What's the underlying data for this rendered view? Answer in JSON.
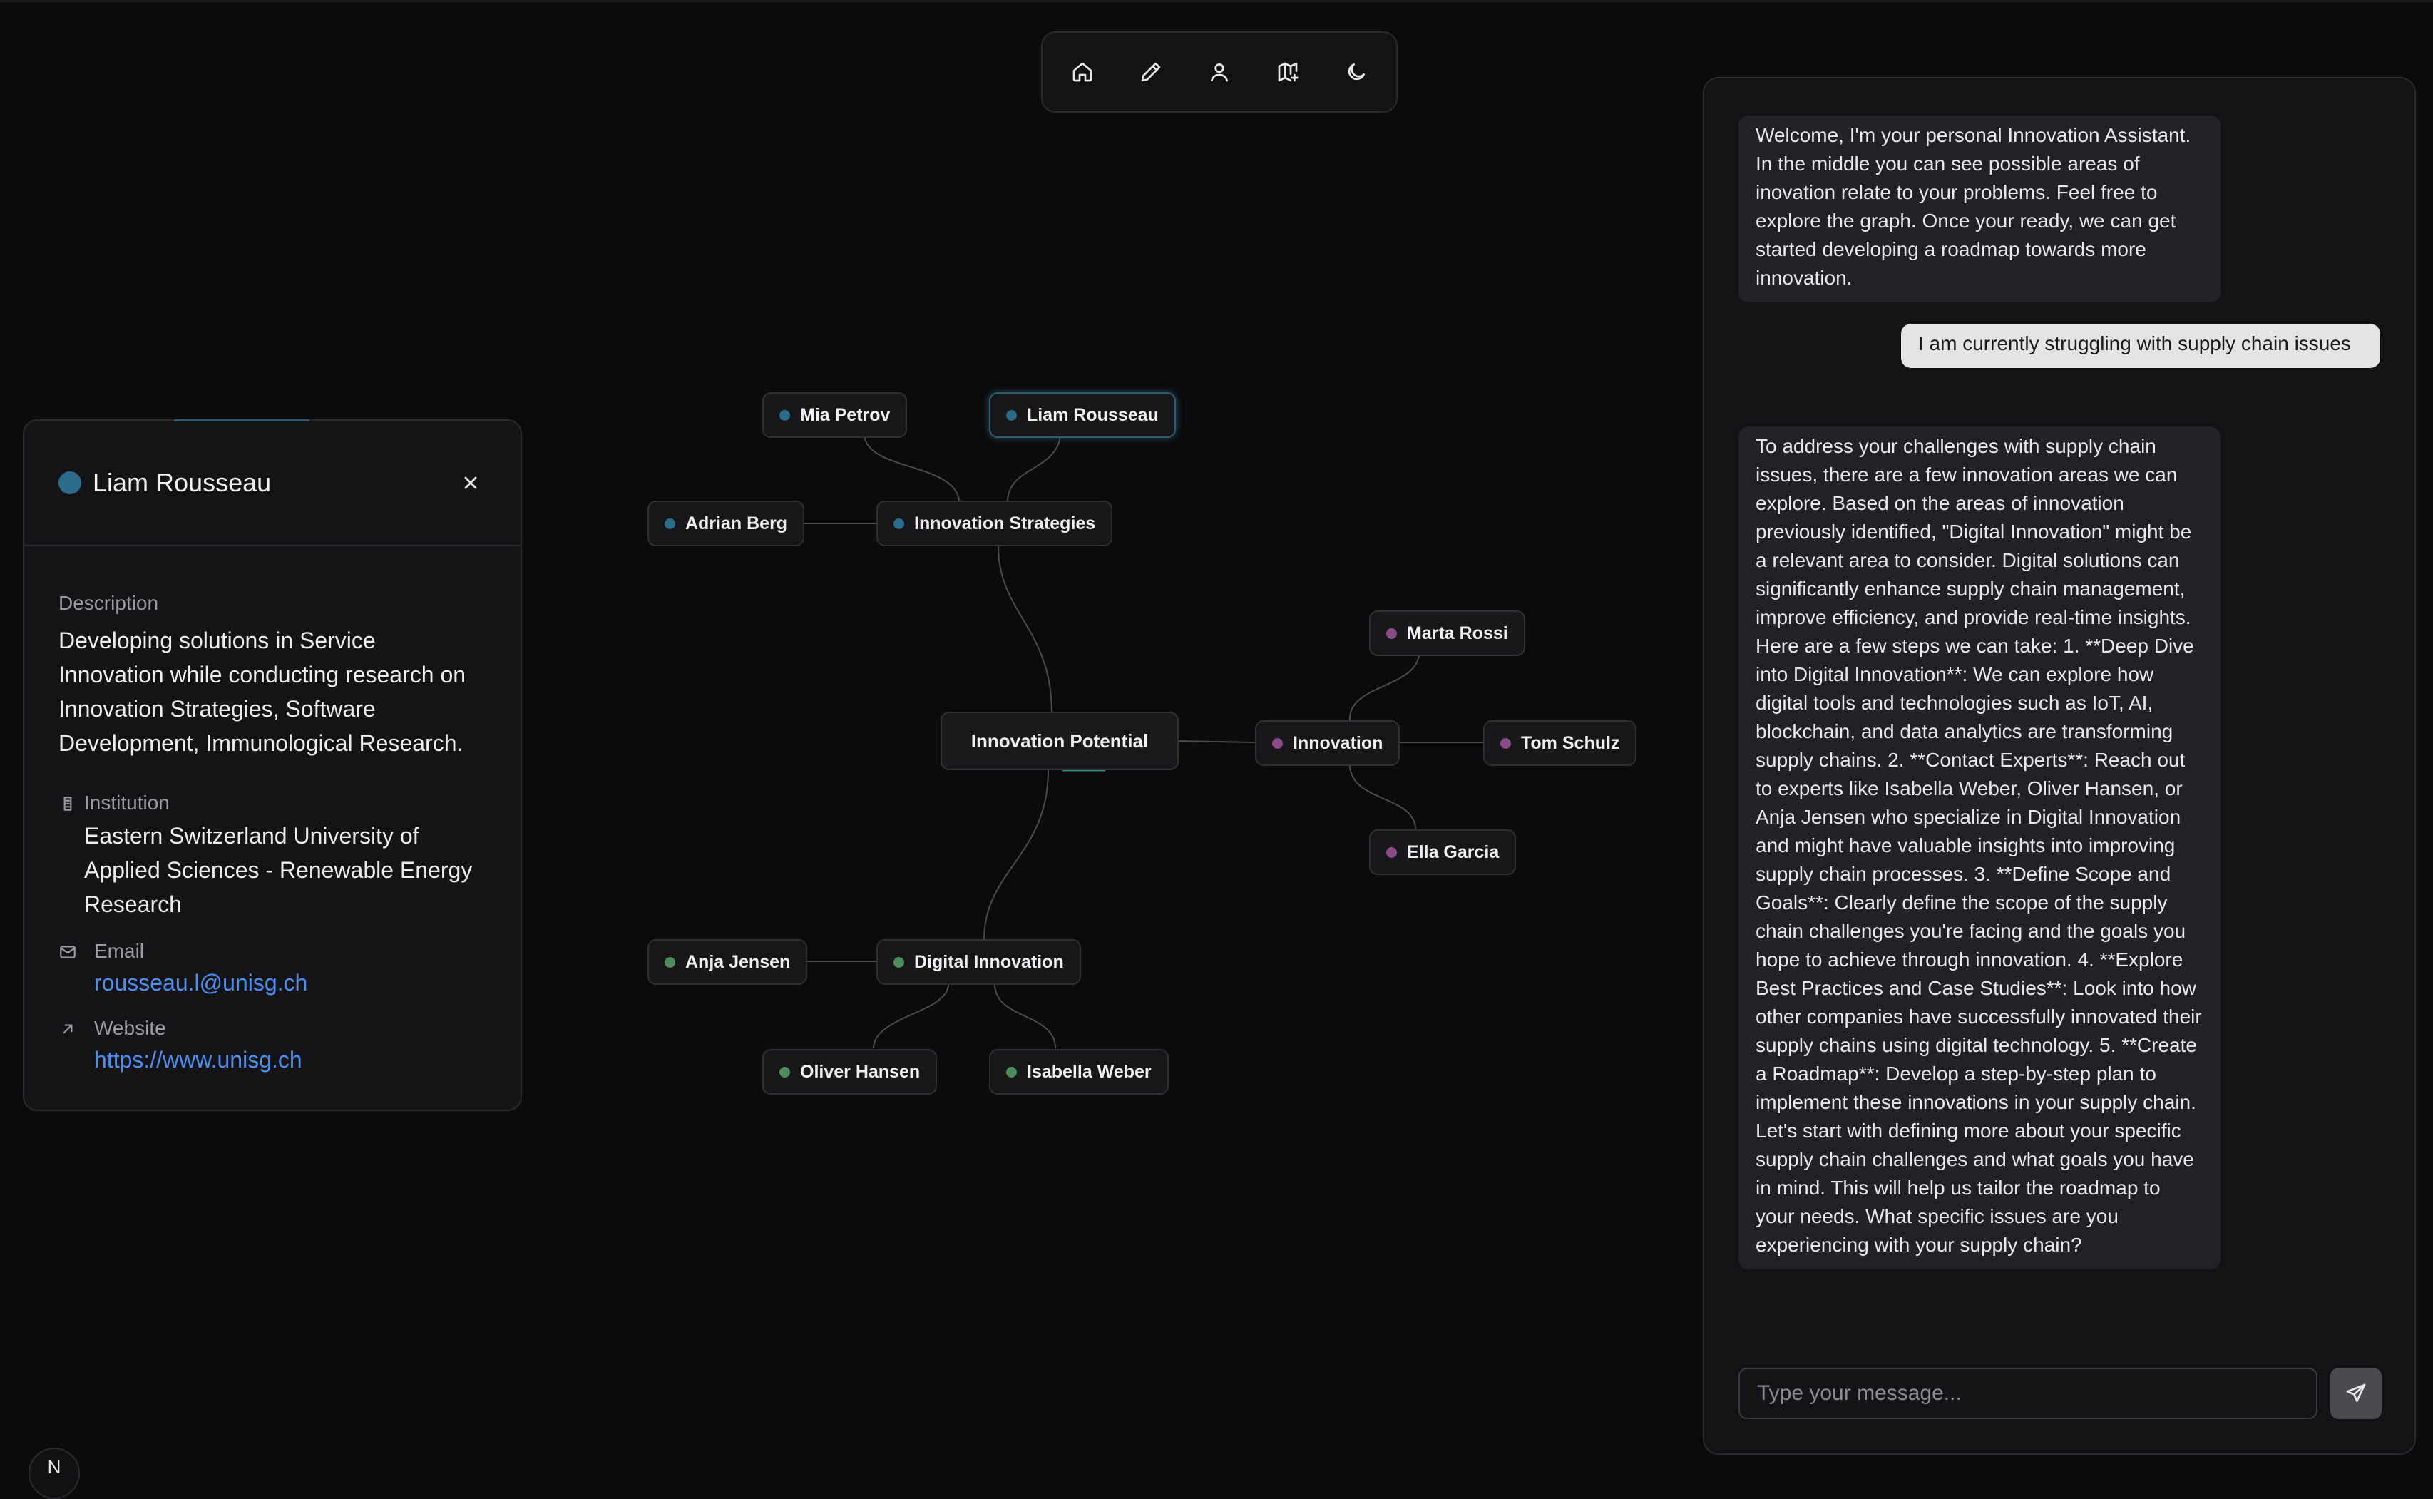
{
  "toolbar": {
    "buttons": [
      {
        "name": "home",
        "icon": "home-icon"
      },
      {
        "name": "edit",
        "icon": "pencil-icon"
      },
      {
        "name": "profile",
        "icon": "user-icon"
      },
      {
        "name": "roadmap",
        "icon": "map-plus-icon"
      },
      {
        "name": "theme",
        "icon": "moon-icon"
      }
    ]
  },
  "graph": {
    "center": {
      "label": "Innovation Potential"
    },
    "hubs": {
      "strategies": {
        "label": "Innovation Strategies",
        "color": "#2b6c8c"
      },
      "innovation": {
        "label": "Innovation",
        "color": "#8a4c86"
      },
      "digital": {
        "label": "Digital Innovation",
        "color": "#4f8a5c"
      }
    },
    "people": {
      "mia": {
        "label": "Mia Petrov",
        "color": "#2b6c8c"
      },
      "liam": {
        "label": "Liam Rousseau",
        "color": "#2b6c8c"
      },
      "adrian": {
        "label": "Adrian Berg",
        "color": "#2b6c8c"
      },
      "marta": {
        "label": "Marta Rossi",
        "color": "#8a4c86"
      },
      "tom": {
        "label": "Tom Schulz",
        "color": "#8a4c86"
      },
      "ella": {
        "label": "Ella Garcia",
        "color": "#8a4c86"
      },
      "anja": {
        "label": "Anja Jensen",
        "color": "#4f8a5c"
      },
      "oliver": {
        "label": "Oliver Hansen",
        "color": "#4f8a5c"
      },
      "isabella": {
        "label": "Isabella Weber",
        "color": "#4f8a5c"
      }
    }
  },
  "detail": {
    "name": "Liam Rousseau",
    "description_label": "Description",
    "description": "Developing solutions in Service Innovation while conducting research on Innovation Strategies, Software Development, Immunological Research.",
    "institution_label": "Institution",
    "institution": "Eastern Switzerland University of Applied Sciences - Renewable Energy Research",
    "email_label": "Email",
    "email": "rousseau.l@unisg.ch",
    "website_label": "Website",
    "website": "https://www.unisg.ch"
  },
  "chat": {
    "messages": [
      {
        "role": "assistant",
        "text": "Welcome, I'm your personal Innovation Assistant. In the middle you can see possible areas of inovation relate to your problems. Feel free to explore the graph. Once your ready, we can get started developing a roadmap towards more innovation."
      },
      {
        "role": "user",
        "text": "I am currently struggling with supply chain issues"
      },
      {
        "role": "assistant",
        "text": "To address your challenges with supply chain issues, there are a few innovation areas we can explore. Based on the areas of innovation previously identified, \"Digital Innovation\" might be a relevant area to consider. Digital solutions can significantly enhance supply chain management, improve efficiency, and provide real-time insights. Here are a few steps we can take: 1. **Deep Dive into Digital Innovation**: We can explore how digital tools and technologies such as IoT, AI, blockchain, and data analytics are transforming supply chains. 2. **Contact Experts**: Reach out to experts like Isabella Weber, Oliver Hansen, or Anja Jensen who specialize in Digital Innovation and might have valuable insights into improving supply chain processes. 3. **Define Scope and Goals**: Clearly define the scope of the supply chain challenges you're facing and the goals you hope to achieve through innovation. 4. **Explore Best Practices and Case Studies**: Look into how other companies have successfully innovated their supply chains using digital technology. 5. **Create a Roadmap**: Develop a step-by-step plan to implement these innovations in your supply chain. Let's start with defining more about your specific supply chain challenges and what goals you have in mind. This will help us tailor the roadmap to your needs. What specific issues are you experiencing with your supply chain?"
      }
    ],
    "input_placeholder": "Type your message...",
    "input_value": ""
  },
  "corner_button": {
    "label": "N"
  }
}
